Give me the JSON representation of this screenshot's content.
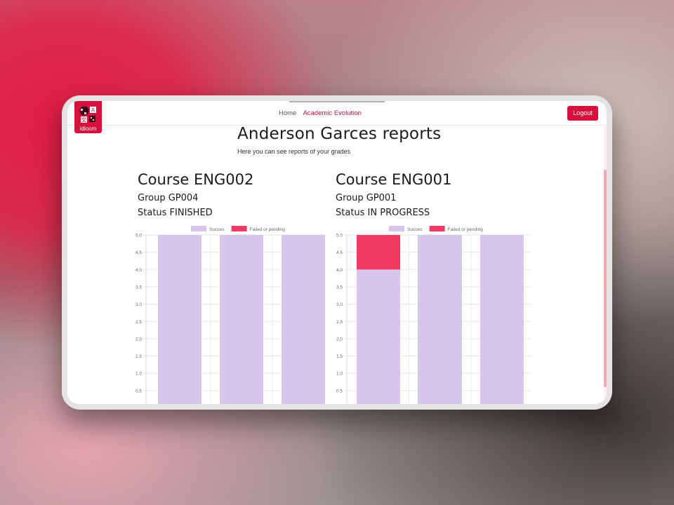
{
  "brand": {
    "logo_text": "idioom"
  },
  "nav": {
    "items": [
      "Home",
      "Academic Evolution"
    ]
  },
  "header": {
    "logout_label": "Logout"
  },
  "page": {
    "title": "Anderson Garces reports",
    "subtitle": "Here you can see reports of your grades"
  },
  "courses": [
    {
      "course": "Course ENG002",
      "group": "Group GP004",
      "status": "Status FINISHED"
    },
    {
      "course": "Course ENG001",
      "group": "Group GP001",
      "status": "Status IN PROGRESS"
    }
  ],
  "colors": {
    "accent": "#d8103e",
    "success": "#d8c5ec",
    "failed": "#f03a62"
  },
  "chart_data": [
    {
      "type": "bar",
      "stacked": true,
      "legend": "top",
      "ylim": [
        0,
        5
      ],
      "ticks": [
        "5.0",
        "4.5",
        "4.0",
        "3.5",
        "3.0",
        "2.5",
        "2.0",
        "1.5",
        "1.0",
        "0.5"
      ],
      "series": [
        {
          "name": "Succes",
          "color": "#d8c5ec",
          "values": [
            5,
            5,
            5
          ]
        },
        {
          "name": "Failed or pending",
          "color": "#f03a62",
          "values": [
            0,
            0,
            0
          ]
        }
      ]
    },
    {
      "type": "bar",
      "stacked": true,
      "legend": "top",
      "ylim": [
        0,
        5
      ],
      "ticks": [
        "5.0",
        "4.5",
        "4.0",
        "3.5",
        "3.0",
        "2.5",
        "2.0",
        "1.5",
        "1.0",
        "0.5"
      ],
      "series": [
        {
          "name": "Succes",
          "color": "#d8c5ec",
          "values": [
            4,
            5,
            5
          ]
        },
        {
          "name": "Failed or pending",
          "color": "#f03a62",
          "values": [
            1,
            0,
            0
          ]
        }
      ]
    }
  ]
}
